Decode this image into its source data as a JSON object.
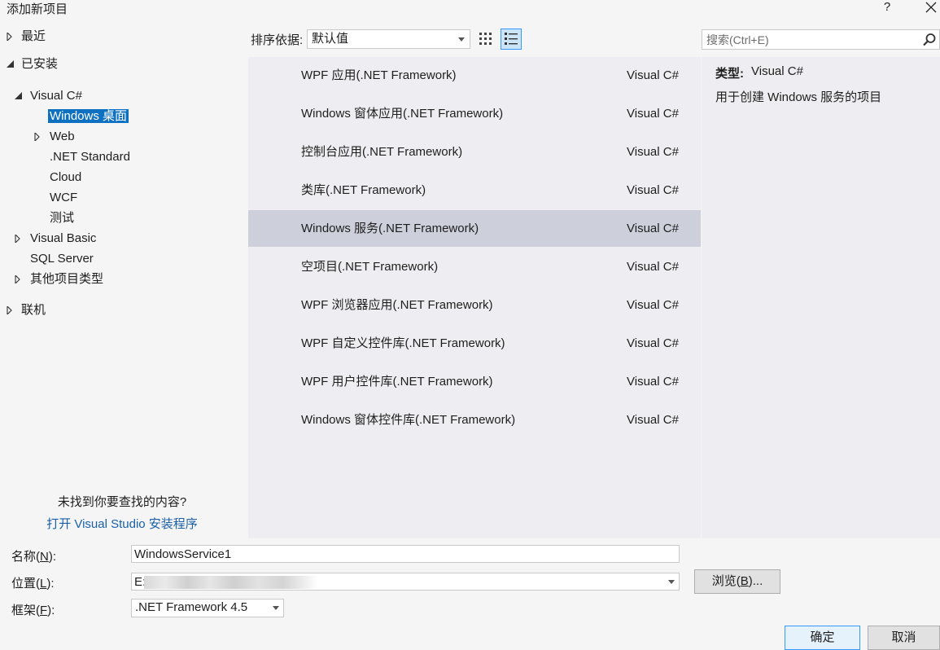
{
  "window": {
    "title": "添加新项目",
    "help_label": "?"
  },
  "tree": {
    "items": [
      {
        "label": "最近"
      },
      {
        "label": "已安装"
      },
      {
        "label": "Visual C#"
      },
      {
        "label": "Windows 桌面"
      },
      {
        "label": "Web"
      },
      {
        "label": ".NET Standard"
      },
      {
        "label": "Cloud"
      },
      {
        "label": "WCF"
      },
      {
        "label": "测试"
      },
      {
        "label": "Visual Basic"
      },
      {
        "label": "SQL Server"
      },
      {
        "label": "其他项目类型"
      },
      {
        "label": "联机"
      }
    ],
    "not_found_text": "未找到你要查找的内容?",
    "installer_link": "打开 Visual Studio 安装程序"
  },
  "toolbar": {
    "sort_label": "排序依据:",
    "sort_value": "默认值"
  },
  "search": {
    "placeholder": "搜索(Ctrl+E)"
  },
  "templates": [
    {
      "name": "WPF 应用(.NET Framework)",
      "lang": "Visual C#"
    },
    {
      "name": "Windows 窗体应用(.NET Framework)",
      "lang": "Visual C#"
    },
    {
      "name": "控制台应用(.NET Framework)",
      "lang": "Visual C#"
    },
    {
      "name": "类库(.NET Framework)",
      "lang": "Visual C#"
    },
    {
      "name": "Windows 服务(.NET Framework)",
      "lang": "Visual C#"
    },
    {
      "name": "空项目(.NET Framework)",
      "lang": "Visual C#"
    },
    {
      "name": "WPF 浏览器应用(.NET Framework)",
      "lang": "Visual C#"
    },
    {
      "name": "WPF 自定义控件库(.NET Framework)",
      "lang": "Visual C#"
    },
    {
      "name": "WPF 用户控件库(.NET Framework)",
      "lang": "Visual C#"
    },
    {
      "name": "Windows 窗体控件库(.NET Framework)",
      "lang": "Visual C#"
    }
  ],
  "details": {
    "type_label": "类型:",
    "type_value": "Visual C#",
    "description": "用于创建 Windows 服务的项目"
  },
  "form": {
    "name_label": "名称(",
    "name_key": "N",
    "name_value": "WindowsService1",
    "location_label": "位置(",
    "location_key": "L",
    "location_value": "E:",
    "framework_label": "框架(",
    "framework_key": "F",
    "framework_value": ".NET Framework 4.5",
    "label_close": "):",
    "browse_label": "浏览(",
    "browse_key": "B",
    "browse_suffix": ")...",
    "ok_label": "确定",
    "cancel_label": "取消"
  }
}
